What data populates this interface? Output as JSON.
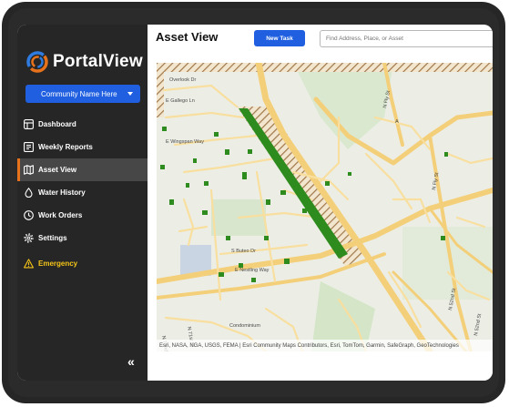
{
  "app": {
    "logo_text": "PortalView",
    "community_select": "Community Name Here"
  },
  "sidebar": {
    "items": [
      {
        "label": "Dashboard",
        "icon": "dashboard-icon",
        "active": false
      },
      {
        "label": "Weekly Reports",
        "icon": "reports-icon",
        "active": false
      },
      {
        "label": "Asset View",
        "icon": "map-icon",
        "active": true
      },
      {
        "label": "Water History",
        "icon": "water-drop-icon",
        "active": false
      },
      {
        "label": "Work Orders",
        "icon": "clock-icon",
        "active": false
      },
      {
        "label": "Settings",
        "icon": "gear-icon",
        "active": false
      },
      {
        "label": "Emergency",
        "icon": "warning-icon",
        "active": false
      }
    ],
    "collapse_glyph": "«"
  },
  "header": {
    "title": "Asset View",
    "new_task_label": "New Task",
    "search_placeholder": "Find Address, Place, or Asset"
  },
  "map": {
    "street_labels": [
      "Overlook Dr",
      "E Gallego Ln",
      "E Wingspan Way",
      "S Buteo Dr",
      "E Nestling Way",
      "N Fly St",
      "N Fly St",
      "N 71st St",
      "N 72nd St",
      "Condominium",
      "N 52nd St",
      "N 52nd St",
      "A"
    ],
    "attribution": "Esri, NASA, NGA, USGS, FEMA | Esri Community Maps Contributors, Esri, TomTom, Garmin, SafeGraph, GeoTechnologies"
  },
  "colors": {
    "accent_blue": "#1f5fe0",
    "active_bar": "#e6721c",
    "emergency": "#f5c518",
    "sidebar_bg": "#262626",
    "road": "#f7d58a",
    "green_asset": "#2e8b1e"
  }
}
